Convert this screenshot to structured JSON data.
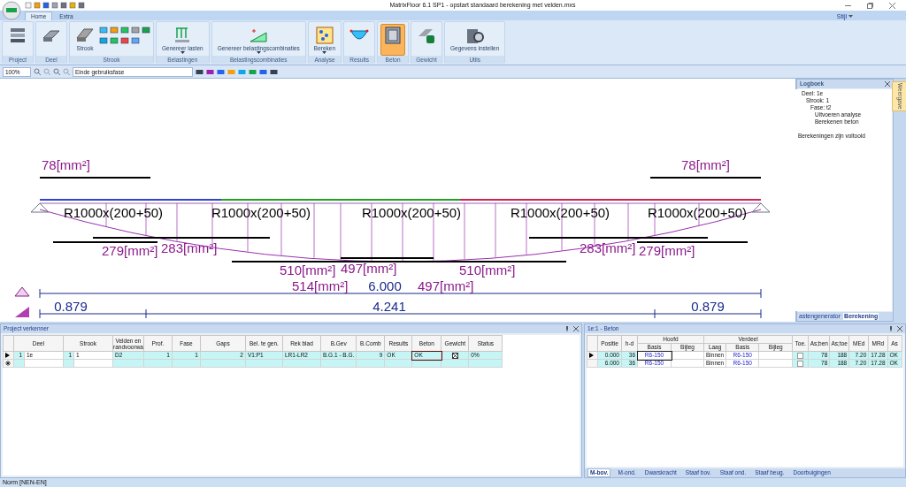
{
  "window": {
    "title": "MatrixFloor 6.1 SP1 - opstart standaard berekening met velden.mxs"
  },
  "ribbon": {
    "tabs": [
      {
        "label": "Home",
        "selected": true
      },
      {
        "label": "Extra",
        "selected": false
      }
    ],
    "style_menu": "Stijl",
    "groups": [
      {
        "label": "Project",
        "selected": false,
        "dropdown": false
      },
      {
        "label": "Deel",
        "selected": false,
        "dropdown": false
      },
      {
        "label": "Strook",
        "button_label": "Strook",
        "selected": false,
        "dropdown": false
      },
      {
        "label": "Belastingen",
        "button_label": "Genereer lasten",
        "selected": false,
        "dropdown": true
      },
      {
        "label": "Belastingscombinaties",
        "button_label": "Genereer belastingscombinaties",
        "selected": false,
        "dropdown": true
      },
      {
        "label": "Analyse",
        "button_label": "Bereken",
        "selected": false,
        "dropdown": true
      },
      {
        "label": "Results",
        "selected": false,
        "dropdown": false
      },
      {
        "label": "Beton",
        "selected": true,
        "dropdown": false
      },
      {
        "label": "Gewicht",
        "selected": false,
        "dropdown": false
      },
      {
        "label": "Utils",
        "button_label": "Gegevens instellen",
        "selected": false,
        "dropdown": false
      }
    ]
  },
  "toolbar": {
    "zoom": "100%",
    "phase": "Einde gebruiksfase"
  },
  "drawing": {
    "labels": [
      {
        "kind": "area",
        "text": "78[mm²]"
      },
      {
        "kind": "area",
        "text": "78[mm²]"
      },
      {
        "kind": "area",
        "text": "279[mm²]"
      },
      {
        "kind": "area",
        "text": "283[mm²]"
      },
      {
        "kind": "area",
        "text": "510[mm²]"
      },
      {
        "kind": "area",
        "text": "497[mm²]"
      },
      {
        "kind": "area",
        "text": "510[mm²]"
      },
      {
        "kind": "area",
        "text": "283[mm²]"
      },
      {
        "kind": "area",
        "text": "279[mm²]"
      },
      {
        "kind": "area",
        "text": "514[mm²]"
      },
      {
        "kind": "area",
        "text": "497[mm²]"
      },
      {
        "kind": "section",
        "text": "R1000x(200+50)"
      },
      {
        "kind": "section",
        "text": "R1000x(200+50)"
      },
      {
        "kind": "section",
        "text": "R1000x(200+50)"
      },
      {
        "kind": "section",
        "text": "R1000x(200+50)"
      },
      {
        "kind": "section",
        "text": "R1000x(200+50)"
      },
      {
        "kind": "dimension",
        "text": "6.000"
      },
      {
        "kind": "dimension",
        "text": "0.879"
      },
      {
        "kind": "dimension",
        "text": "4.241"
      },
      {
        "kind": "dimension",
        "text": "0.879"
      }
    ]
  },
  "logbook": {
    "title": "Logboek",
    "entries": [
      {
        "text": "Deel: 1e",
        "children": [
          {
            "text": "Strook: 1",
            "children": [
              {
                "text": "Fase: t2",
                "children": [
                  {
                    "text": "Uitvoeren analyse"
                  },
                  {
                    "text": "Berekenen beton"
                  }
                ]
              }
            ]
          }
        ]
      }
    ],
    "message": "Berekeningen zijn voltooid",
    "tabs": [
      {
        "label": "astengenerator",
        "selected": false
      },
      {
        "label": "Berekening",
        "selected": true
      }
    ]
  },
  "side_tab": "Weergave",
  "project_explorer": {
    "title": "Project verkenner",
    "columns": [
      "Deel",
      "Strook",
      "Velden en randvoorwa",
      "Prof.",
      "Fase",
      "Gaps",
      "Bel. te gen.",
      "Rek blad",
      "B.Gev",
      "B.Comb",
      "Results",
      "Beton",
      "Gewicht",
      "Status"
    ],
    "rows": [
      {
        "deel_nr": "1",
        "deel": "1e",
        "strook_nr": "1",
        "strook": "1",
        "velden": "D2",
        "prof": "1",
        "fase": "1",
        "gaps": "2",
        "bel": "V1:P1",
        "rek": "LR1-LR2",
        "bgev": "B.G.1 - B.G.",
        "bcomb": "9",
        "results": "OK",
        "beton": "OK",
        "gewicht_checked": true,
        "status": "0%"
      }
    ]
  },
  "beton_panel": {
    "title": "1e:1 - Beton",
    "headers": {
      "positie": "Positie",
      "hd": "h-d",
      "hoofd": "Hoofd",
      "verdeel": "Verdeel",
      "hoofd_basis": "Basis",
      "hoofd_bijleg": "Bijleg",
      "laag": "Laag",
      "verdeel_basis": "Basis",
      "verdeel_bijleg": "Bijleg",
      "toe": "Toe.",
      "asben": "As;ben",
      "astoe": "As;toe",
      "med": "MEd",
      "mrd": "MRd",
      "as": "As"
    },
    "rows": [
      {
        "positie": "0.000",
        "hd": "36",
        "hoofd_basis": "R6-150",
        "laag": "Binnen",
        "verdeel_basis": "R6-150",
        "toe": false,
        "asben": "78",
        "astoe": "188",
        "med": "7.20",
        "mrd": "17.28",
        "as": "OK"
      },
      {
        "positie": "6.000",
        "hd": "36",
        "hoofd_basis": "R6-150",
        "laag": "Binnen",
        "verdeel_basis": "R6-150",
        "toe": false,
        "asben": "78",
        "astoe": "188",
        "med": "7.20",
        "mrd": "17.28",
        "as": "OK"
      }
    ],
    "tabs": [
      {
        "label": "M-bov.",
        "selected": true
      },
      {
        "label": "M-ond.",
        "selected": false
      },
      {
        "label": "Dwarskracht",
        "selected": false
      },
      {
        "label": "Staaf bov.",
        "selected": false
      },
      {
        "label": "Staaf ond.",
        "selected": false
      },
      {
        "label": "Staaf beug.",
        "selected": false
      },
      {
        "label": "Doorbuigingen",
        "selected": false
      }
    ]
  },
  "status_bar": "Norm [NEN-EN]"
}
